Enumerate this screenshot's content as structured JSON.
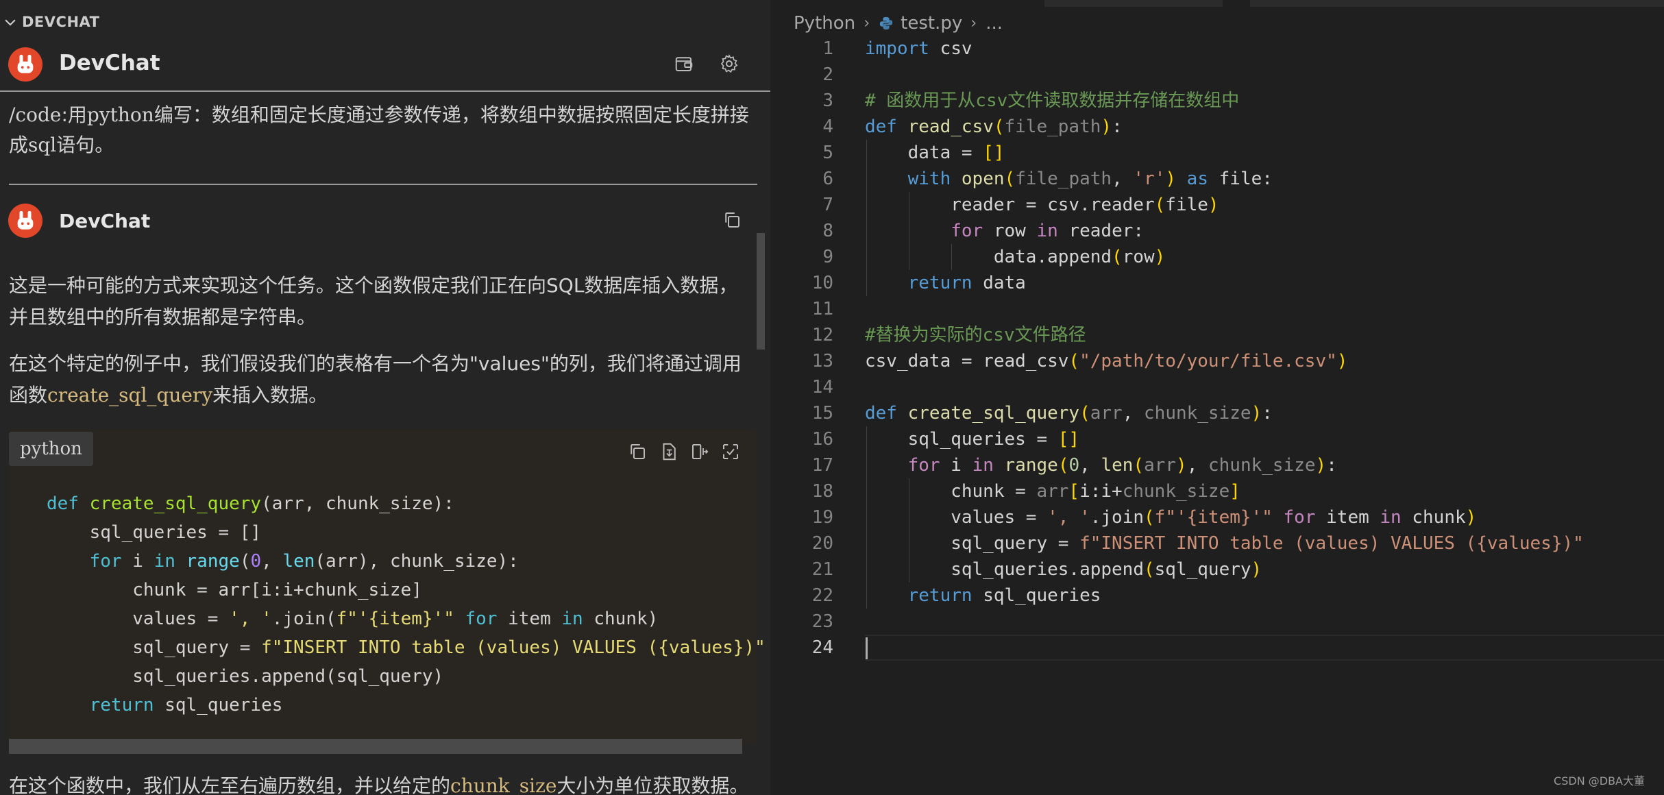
{
  "chat": {
    "section_title": "DEVCHAT",
    "header_name": "DevChat",
    "user_message_parts": [
      "/code",
      ":用",
      "python",
      "编写：数组和固定长度通过参数传递，将数组中数据按照固定长度拼接成",
      "sql",
      "语句。"
    ],
    "reply_name": "DevChat",
    "para1": "这是一种可能的方式来实现这个任务。这个函数假定我们正在向SQL数据库插入数据，并且数组中的所有数据都是字符串。",
    "para2_a": "在这个特定的例子中，我们假设我们的表格有一个名为\"values\"的列，我们将通过调用函数",
    "para2_code": "create_sql_query",
    "para2_b": "来插入数据。",
    "code_lang": "python",
    "code_lines": [
      "def create_sql_query(arr, chunk_size):",
      "    sql_queries = []",
      "    for i in range(0, len(arr), chunk_size):",
      "        chunk = arr[i:i+chunk_size]",
      "        values = ', '.join(f\"'{item}'\" for item in chunk)",
      "        sql_query = f\"INSERT INTO table (values) VALUES ({values})\"",
      "        sql_queries.append(sql_query)",
      "    return sql_queries"
    ],
    "para3_a": "在这个函数中，我们从左至右遍历数组，并以给定的",
    "para3_code": "chunk_size",
    "para3_b": "大小为单位获取数据。",
    "icons": [
      "chevron-down-icon",
      "wallet-icon",
      "gear-icon",
      "copy-icon",
      "insert-icon",
      "diff-icon",
      "apply-icon"
    ]
  },
  "editor": {
    "breadcrumb": [
      "Python",
      "test.py",
      "..."
    ],
    "lines": [
      "import csv",
      "",
      "# 函数用于从csv文件读取数据并存储在数组中",
      "def read_csv(file_path):",
      "    data = []",
      "    with open(file_path, 'r') as file:",
      "        reader = csv.reader(file)",
      "        for row in reader:",
      "            data.append(row)",
      "    return data",
      "",
      "#替换为实际的csv文件路径",
      "csv_data = read_csv(\"/path/to/your/file.csv\")",
      "",
      "def create_sql_query(arr, chunk_size):",
      "    sql_queries = []",
      "    for i in range(0, len(arr), chunk_size):",
      "        chunk = arr[i:i+chunk_size]",
      "        values = ', '.join(f\"'{item}'\" for item in chunk)",
      "        sql_query = f\"INSERT INTO table (values) VALUES ({values})\"",
      "        sql_queries.append(sql_query)",
      "    return sql_queries",
      "",
      ""
    ],
    "line_numbers": [
      "1",
      "2",
      "3",
      "4",
      "5",
      "6",
      "7",
      "8",
      "9",
      "10",
      "11",
      "12",
      "13",
      "14",
      "15",
      "16",
      "17",
      "18",
      "19",
      "20",
      "21",
      "22",
      "23",
      "24"
    ],
    "current_line": "24",
    "watermark": "CSDN @DBA大董"
  },
  "colors": {
    "accent_avatar": "#e2472a",
    "keyword": "#569cd6",
    "comment": "#6a9955",
    "string": "#ce9178",
    "function": "#dcdcaa"
  }
}
